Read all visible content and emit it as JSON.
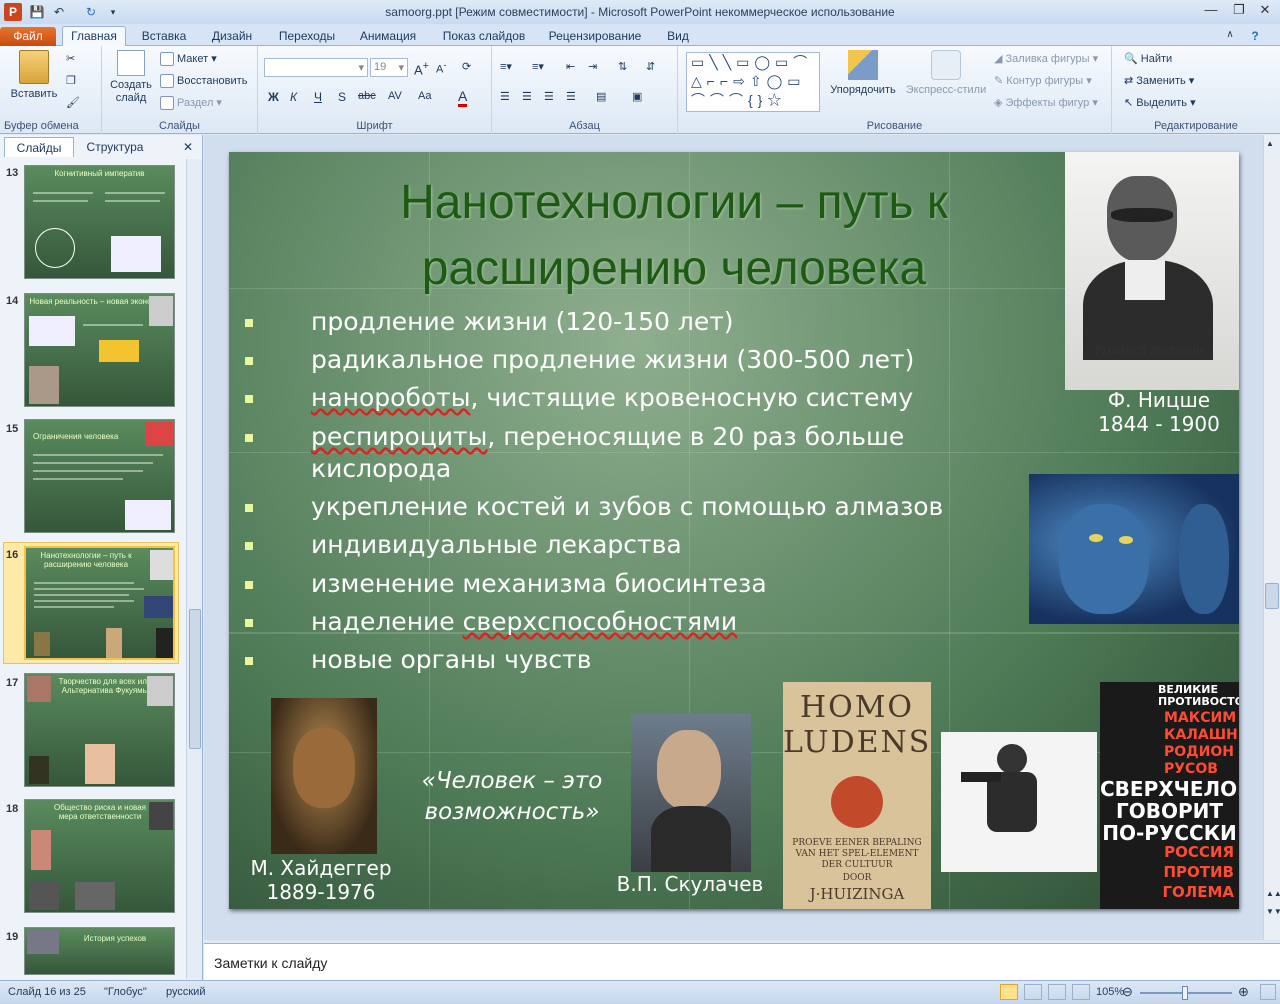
{
  "window": {
    "title": "samoorg.ppt [Режим совместимости]  -  Microsoft PowerPoint некоммерческое использование"
  },
  "tabs": [
    "Файл",
    "Главная",
    "Вставка",
    "Дизайн",
    "Переходы",
    "Анимация",
    "Показ слайдов",
    "Рецензирование",
    "Вид"
  ],
  "ribbon": {
    "clipboard": {
      "paste": "Вставить",
      "group": "Буфер обмена"
    },
    "slides": {
      "new_slide": "Создать слайд",
      "layout": "Макет",
      "reset": "Восстановить",
      "section": "Раздел",
      "group": "Слайды"
    },
    "font": {
      "size": "19",
      "bold": "Ж",
      "italic": "К",
      "underline": "Ч",
      "shadow": "S",
      "strike": "abc",
      "spacing": "AV",
      "case": "Aa",
      "color": "A",
      "group": "Шрифт"
    },
    "paragraph": {
      "group": "Абзац"
    },
    "drawing": {
      "arrange": "Упорядочить",
      "quick_styles": "Экспресс-стили",
      "fill": "Заливка фигуры",
      "outline": "Контур фигуры",
      "effects": "Эффекты фигур",
      "group": "Рисование"
    },
    "editing": {
      "find": "Найти",
      "replace": "Заменить",
      "select": "Выделить",
      "group": "Редактирование"
    }
  },
  "left_pane": {
    "tab_slides": "Слайды",
    "tab_outline": "Структура",
    "thumbs": [
      {
        "num": "13",
        "title": "Когнитивный императив"
      },
      {
        "num": "14",
        "title": "Новая реальность – новая экономика"
      },
      {
        "num": "15",
        "title": "Ограничения человека"
      },
      {
        "num": "16",
        "title": "Нанотехнологии – путь к расширению человека"
      },
      {
        "num": "17",
        "title": "Творчество для всех или Альтернатива Фукуямы"
      },
      {
        "num": "18",
        "title": "Общество риска и новая мера ответственности"
      },
      {
        "num": "19",
        "title": "История успехов"
      }
    ]
  },
  "slide": {
    "title_line1": "Нанотехнологии – путь к",
    "title_line2": "расширению человека",
    "bullets": [
      "продление жизни (120-150 лет)",
      "радикальное продление жизни (300-500 лет)",
      "нанороботы, чистящие кровеносную систему",
      "респироциты, переносящие в 20 раз больше",
      "кислорода",
      "укрепление костей и зубов с помощью алмазов",
      "индивидуальные лекарства",
      "изменение механизма биосинтеза",
      "наделение сверхспособностями",
      "новые органы чувств"
    ],
    "nietzsche_name": "Ф. Ницше",
    "nietzsche_years": "1844 - 1900",
    "quote_line1": "«Человек – это",
    "quote_line2": "возможность»",
    "heidegger_name": "М. Хайдеггер",
    "heidegger_years": "1889-1976",
    "skulachev": "В.П. Скулачев",
    "book1": {
      "title1": "HOMO",
      "title2": "LUDENS",
      "sub": "PROEVE EENER BEPALING VAN HET SPEL-ELEMENT DER CULTUUR",
      "author": "J·HUIZINGA",
      "door": "DOOR"
    },
    "book2": {
      "top": "ВЕЛИКИЕ ПРОТИВОСТОЯНИЯ",
      "authors": "МАКСИМ КАЛАШНИКОВ РОДИОН РУСОВ",
      "title": "СВЕРХЧЕЛОВЕК ГОВОРИТ ПО-РУССКИ",
      "bottom": "РОССИЯ ПРОТИВ ГОЛЕМА"
    }
  },
  "notes": {
    "placeholder": "Заметки к слайду"
  },
  "status": {
    "slide": "Слайд 16 из 25",
    "theme": "\"Глобус\"",
    "lang": "русский",
    "zoom": "105%"
  },
  "colors": {
    "file_tab": "#d85a1a",
    "slide_bg": "#5a8560",
    "title": "#1f5a14"
  }
}
